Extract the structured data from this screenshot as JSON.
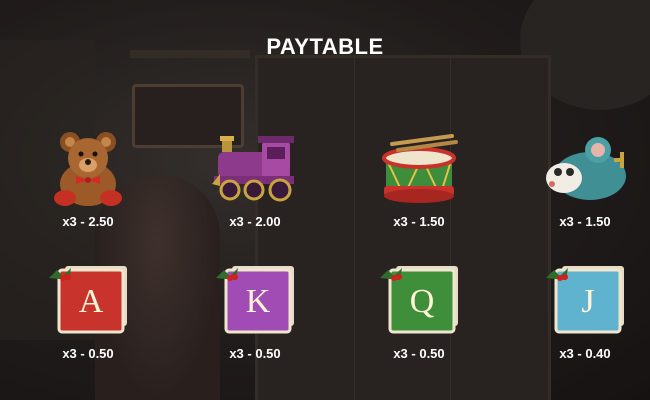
{
  "paytable": {
    "title": "PAYTABLE",
    "symbols": [
      {
        "name": "Teddy Bear",
        "icon": "teddy-bear-icon",
        "payout": "x3 - 2.50"
      },
      {
        "name": "Toy Train",
        "icon": "toy-train-icon",
        "payout": "x3 - 2.00"
      },
      {
        "name": "Drum",
        "icon": "drum-icon",
        "payout": "x3 - 1.50"
      },
      {
        "name": "Toy Mouse",
        "icon": "toy-mouse-icon",
        "payout": "x3 - 1.50"
      },
      {
        "name": "A",
        "icon": "card-a-icon",
        "letter": "A",
        "color": "#c8342b",
        "payout": "x3 - 0.50"
      },
      {
        "name": "K",
        "icon": "card-k-icon",
        "letter": "K",
        "color": "#a14bb5",
        "payout": "x3 - 0.50"
      },
      {
        "name": "Q",
        "icon": "card-q-icon",
        "letter": "Q",
        "color": "#3f8f3a",
        "payout": "x3 - 0.50"
      },
      {
        "name": "J",
        "icon": "card-j-icon",
        "letter": "J",
        "color": "#5fb3cf",
        "payout": "x3 - 0.40"
      }
    ]
  },
  "colors": {
    "text": "#ffffff",
    "background": "#2a2524"
  }
}
